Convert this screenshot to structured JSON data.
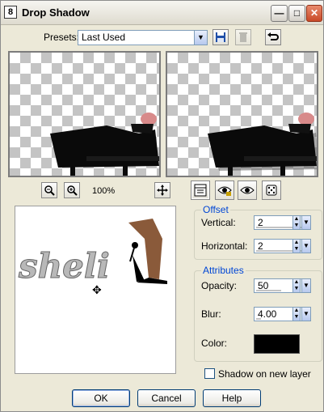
{
  "window": {
    "title": "Drop Shadow",
    "icon_text": "8"
  },
  "titlebar_buttons": {
    "minimize": "—",
    "maximize": "□",
    "close": "✕"
  },
  "presets": {
    "label": "Presets:",
    "value": "Last Used"
  },
  "zoom": {
    "level": "100%"
  },
  "preview_logo": {
    "text": "sheli"
  },
  "offset": {
    "title": "Offset",
    "vertical_label": "Vertical:",
    "vertical_value": "2",
    "horizontal_label": "Horizontal:",
    "horizontal_value": "2"
  },
  "attributes": {
    "title": "Attributes",
    "opacity_label": "Opacity:",
    "opacity_value": "50",
    "blur_label": "Blur:",
    "blur_value": "4.00",
    "color_label": "Color:",
    "color_hex": "#000000"
  },
  "shadow_new_layer": {
    "label": "Shadow on new layer",
    "checked": false
  },
  "buttons": {
    "ok": "OK",
    "cancel": "Cancel",
    "help": "Help"
  }
}
